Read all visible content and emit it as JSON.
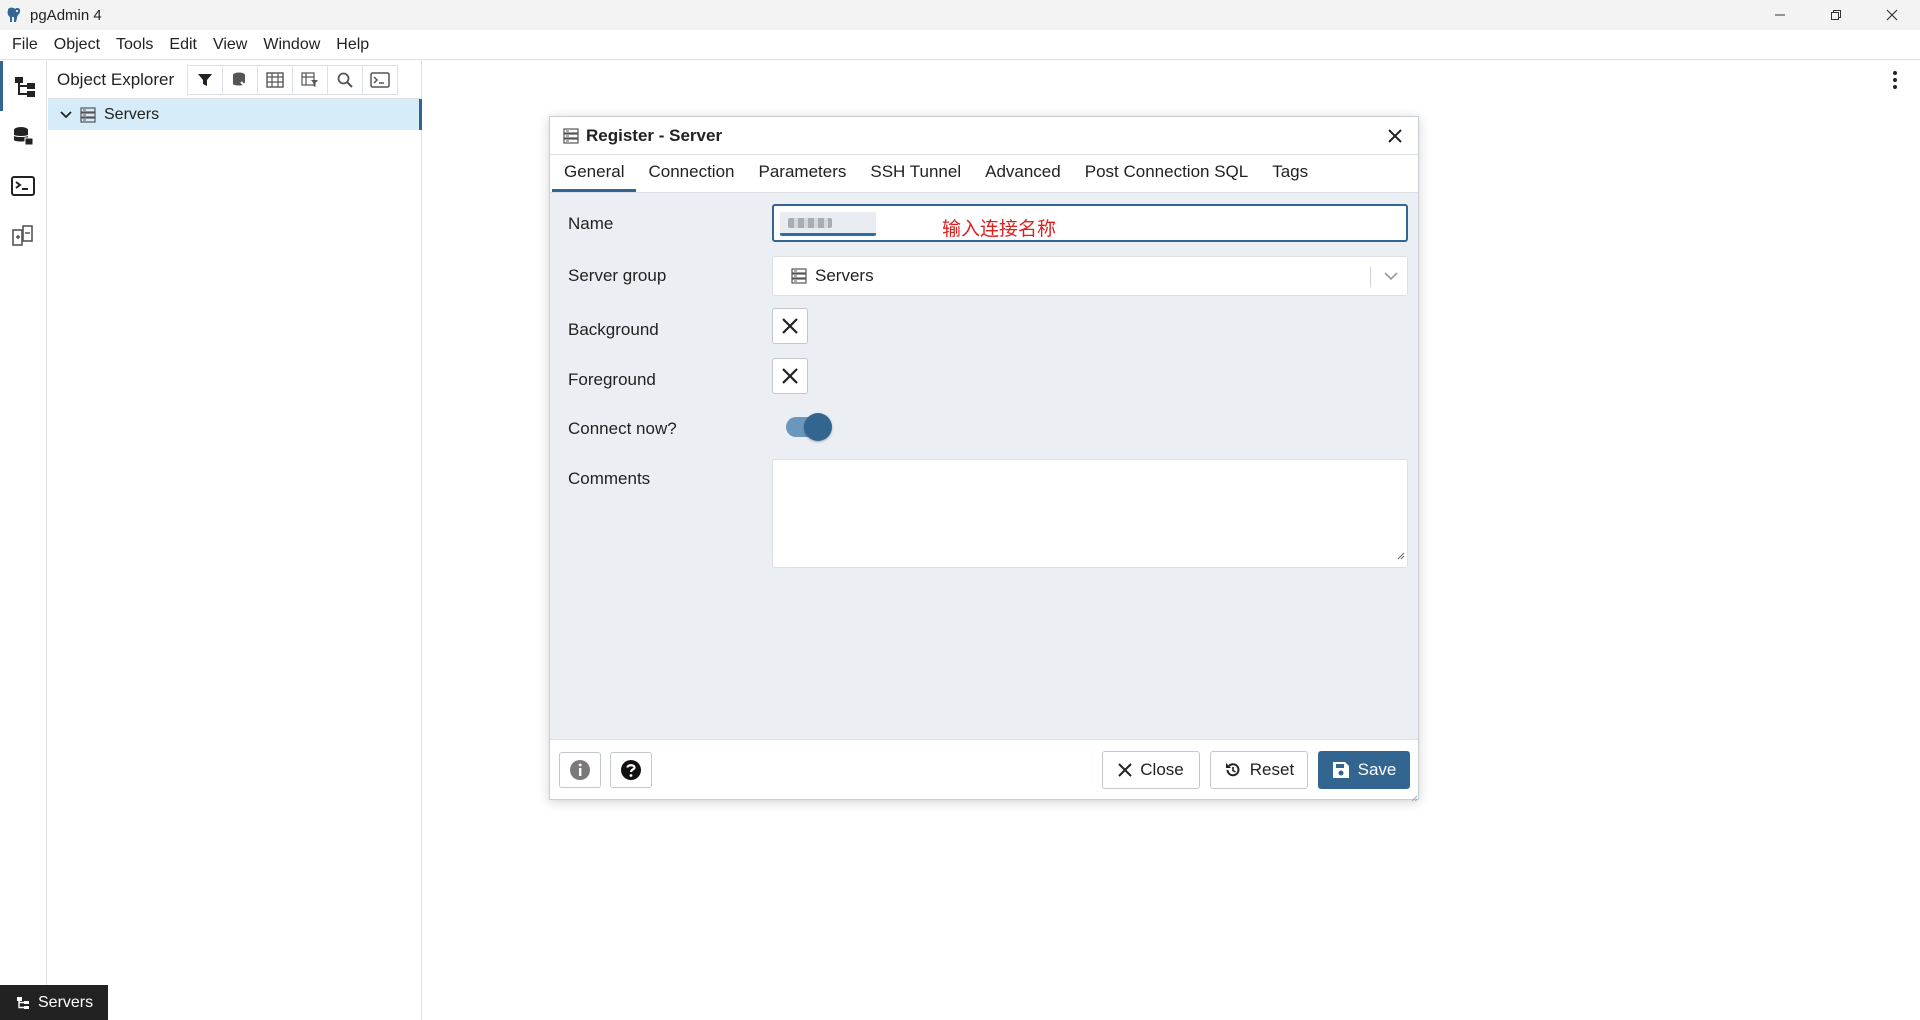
{
  "window": {
    "title": "pgAdmin 4"
  },
  "menu": {
    "items": [
      "File",
      "Object",
      "Tools",
      "Edit",
      "View",
      "Window",
      "Help"
    ]
  },
  "explorer": {
    "title": "Object Explorer",
    "tree": [
      {
        "label": "Servers",
        "expanded": true,
        "selected": true
      }
    ]
  },
  "status_tab": {
    "label": "Servers"
  },
  "dialog": {
    "title": "Register - Server",
    "tabs": [
      "General",
      "Connection",
      "Parameters",
      "SSH Tunnel",
      "Advanced",
      "Post Connection SQL",
      "Tags"
    ],
    "active_tab": "General",
    "fields": {
      "name": {
        "label": "Name",
        "annotation": "输入连接名称"
      },
      "server_group": {
        "label": "Server group",
        "value": "Servers"
      },
      "background": {
        "label": "Background"
      },
      "foreground": {
        "label": "Foreground"
      },
      "connect_now": {
        "label": "Connect now?",
        "checked": true
      },
      "comments": {
        "label": "Comments",
        "value": ""
      }
    },
    "buttons": {
      "close": "Close",
      "reset": "Reset",
      "save": "Save"
    }
  },
  "colors": {
    "accent": "#326690",
    "selection": "#d6ecf8",
    "annotation": "#e02020",
    "dialog_bg": "#ebeef3"
  }
}
